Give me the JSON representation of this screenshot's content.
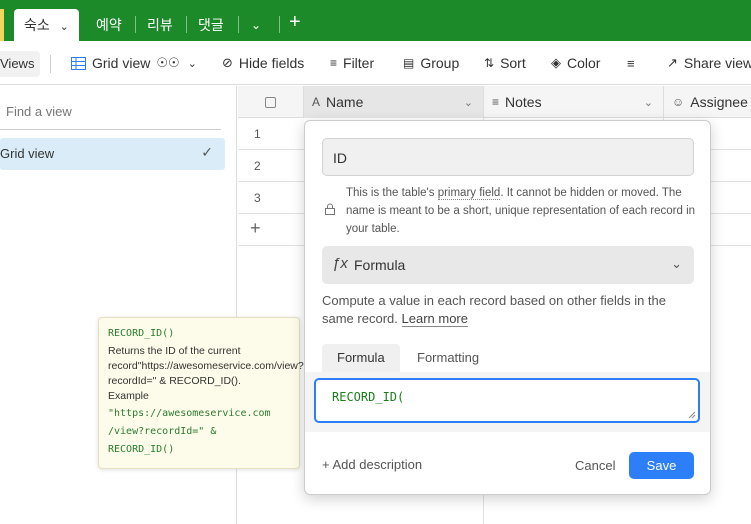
{
  "tabs": [
    "숙소",
    "예약",
    "리뷰",
    "댓글"
  ],
  "toolbar": {
    "views": "Views",
    "grid_view": "Grid view",
    "hide_fields": "Hide fields",
    "filter": "Filter",
    "group": "Group",
    "sort": "Sort",
    "color": "Color",
    "share_view": "Share view"
  },
  "sidebar": {
    "find_placeholder": "Find a view",
    "grid_view": "Grid view"
  },
  "grid": {
    "columns": [
      "Name",
      "Notes",
      "Assignee"
    ],
    "rows": [
      "1",
      "2",
      "3"
    ]
  },
  "popup": {
    "field_name": "ID",
    "primary_note_prefix": "This is the table's ",
    "primary_field_link": "primary field",
    "primary_note_suffix": ". It cannot be hidden or moved. The name is meant to be a short, unique representation of each record in your table.",
    "field_type": "Formula",
    "type_description": "Compute a value in each record based on other fields in the same record.",
    "learn_more": "Learn more",
    "tab_formula": "Formula",
    "tab_formatting": "Formatting",
    "formula_value": "RECORD_ID(",
    "add_description": "+ Add description",
    "cancel": "Cancel",
    "save": "Save"
  },
  "tooltip": {
    "function_name": "RECORD_ID()",
    "description": "Returns the ID of the current record\"https://awesomeservice.com/view?recordId=\" & RECORD_ID().",
    "example_label": "Example",
    "example_line1": "\"https://awesomeservice.com",
    "example_line2": "/view?recordId=\" &",
    "example_line3": "RECORD_ID()"
  },
  "colors": {
    "topbar": "#1d8a2a",
    "accent_blue": "#2d7ff9",
    "selected_view": "#d9ecf7",
    "formula_green": "#1a7f1a"
  }
}
